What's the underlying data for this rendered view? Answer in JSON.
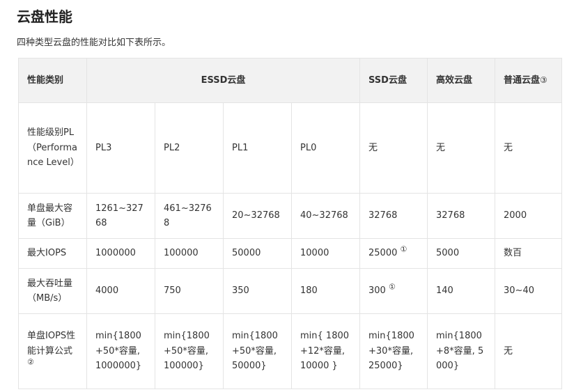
{
  "page": {
    "title": "云盘性能",
    "intro": "四种类型云盘的性能对比如下表所示。"
  },
  "table": {
    "headers": {
      "category": "性能类别",
      "essd": "ESSD云盘",
      "ssd": "SSD云盘",
      "efficiency": "高效云盘",
      "basic": "普通云盘",
      "basic_mark": "③"
    },
    "rows": {
      "pl": {
        "label": "性能级别PL（Performance Level）",
        "essd_pl3": "PL3",
        "essd_pl2": "PL2",
        "essd_pl1": "PL1",
        "essd_pl0": "PL0",
        "ssd": "无",
        "efficiency": "无",
        "basic": "无"
      },
      "capacity": {
        "label": "单盘最大容量（GiB）",
        "essd_pl3": "1261~32768",
        "essd_pl2": "461~32768",
        "essd_pl1": "20~32768",
        "essd_pl0": "40~32768",
        "ssd": "32768",
        "efficiency": "32768",
        "basic": "2000"
      },
      "iops": {
        "label": "最大IOPS",
        "essd_pl3": "1000000",
        "essd_pl2": "100000",
        "essd_pl1": "50000",
        "essd_pl0": "10000",
        "ssd": "25000",
        "ssd_mark": "①",
        "efficiency": "5000",
        "basic": "数百"
      },
      "throughput": {
        "label": "最大吞吐量（MB/s）",
        "essd_pl3": "4000",
        "essd_pl2": "750",
        "essd_pl1": "350",
        "essd_pl0": "180",
        "ssd": "300",
        "ssd_mark": "①",
        "efficiency": "140",
        "basic": "30~40"
      },
      "formula": {
        "label": "单盘IOPS性能计算公式",
        "label_mark": "②",
        "essd_pl3": "min{1800+50*容量, 1000000}",
        "essd_pl2": "min{1800+50*容量, 100000}",
        "essd_pl1": "min{1800+50*容量, 50000}",
        "essd_pl0": "min{ 1800+12*容量, 10000 }",
        "ssd": "min{1800+30*容量, 25000}",
        "efficiency": "min{1800+8*容量, 5000}",
        "basic": "无"
      }
    }
  }
}
